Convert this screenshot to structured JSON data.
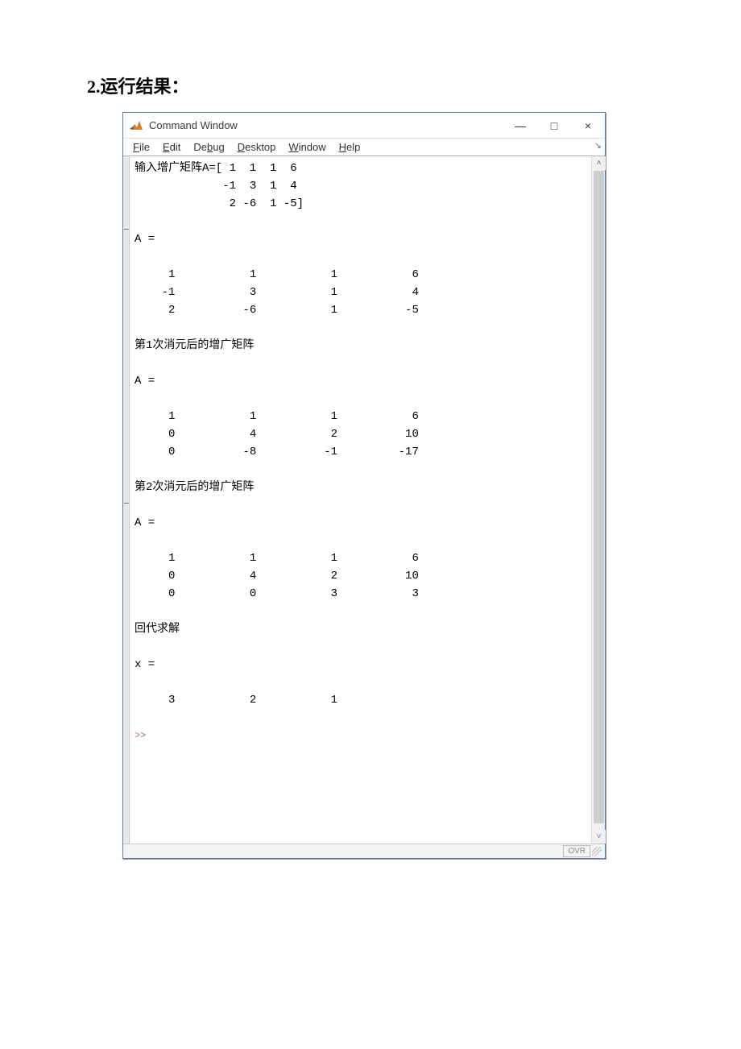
{
  "page": {
    "heading": "2.运行结果："
  },
  "window": {
    "title": "Command Window",
    "controls": {
      "minimize": "—",
      "maximize": "□",
      "close": "×"
    }
  },
  "menus": [
    "File",
    "Edit",
    "Debug",
    "Desktop",
    "Window",
    "Help"
  ],
  "content": {
    "line1": "输入增广矩阵A=[ 1  1  1  6",
    "line2": "             -1  3  1  4",
    "line3": "              2 -6  1 -5]",
    "blank": "",
    "Aeq": "A =",
    "m1": "     1           1           1           6",
    "m2": "    -1           3           1           4",
    "m3": "     2          -6           1          -5",
    "step1": "第1次消元后的增广矩阵",
    "m4": "     1           1           1           6",
    "m5": "     0           4           2          10",
    "m6": "     0          -8          -1         -17",
    "step2": "第2次消元后的增广矩阵",
    "m7": "     1           1           1           6",
    "m8": "     0           4           2          10",
    "m9": "     0           0           3           3",
    "back": "回代求解",
    "xeq": "x =",
    "m10": "     3           2           1",
    "prompt": ">> "
  },
  "status": {
    "ovr": "OVR"
  },
  "chart_data": {
    "type": "table",
    "title": "MATLAB Command Window output — Gaussian elimination",
    "input_matrix_raw": "[ 1  1  1  6; -1  3  1  4;  2 -6  1 -5]",
    "sections": [
      {
        "label": "A =",
        "rows": [
          [
            1,
            1,
            1,
            6
          ],
          [
            -1,
            3,
            1,
            4
          ],
          [
            2,
            -6,
            1,
            -5
          ]
        ]
      },
      {
        "label": "第1次消元后的增广矩阵  A =",
        "rows": [
          [
            1,
            1,
            1,
            6
          ],
          [
            0,
            4,
            2,
            10
          ],
          [
            0,
            -8,
            -1,
            -17
          ]
        ]
      },
      {
        "label": "第2次消元后的增广矩阵  A =",
        "rows": [
          [
            1,
            1,
            1,
            6
          ],
          [
            0,
            4,
            2,
            10
          ],
          [
            0,
            0,
            3,
            3
          ]
        ]
      },
      {
        "label": "回代求解  x =",
        "rows": [
          [
            3,
            2,
            1
          ]
        ]
      }
    ]
  }
}
